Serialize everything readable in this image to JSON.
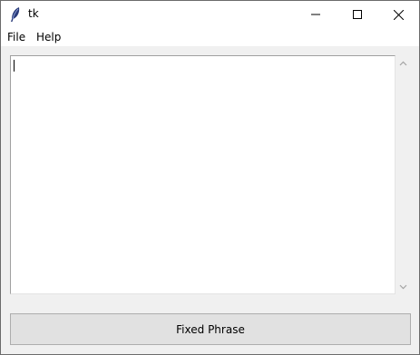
{
  "window": {
    "title": "tk",
    "icon": "tk-feather-icon"
  },
  "menu": {
    "items": [
      {
        "label": "File"
      },
      {
        "label": "Help"
      }
    ]
  },
  "editor": {
    "value": ""
  },
  "button": {
    "label": "Fixed Phrase"
  }
}
